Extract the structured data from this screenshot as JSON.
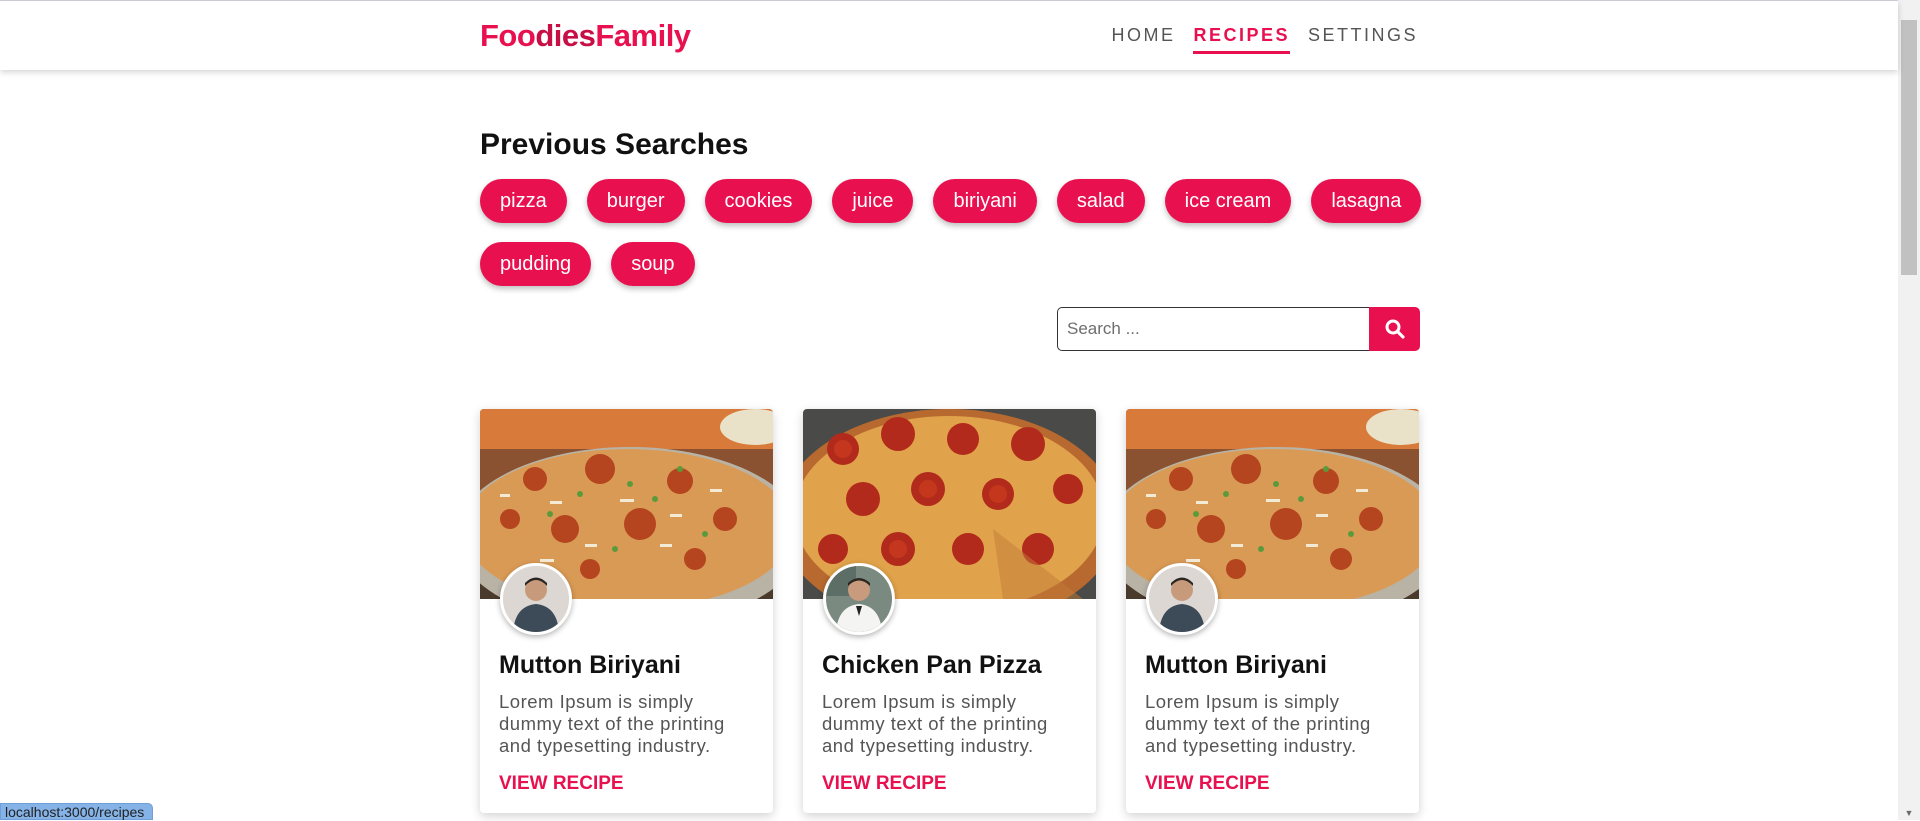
{
  "header": {
    "logo": {
      "part1": "Foo",
      "part2": "dies",
      "part3": "Family"
    },
    "nav": [
      {
        "label": "HOME",
        "active": false
      },
      {
        "label": "RECIPES",
        "active": true
      },
      {
        "label": "SETTINGS",
        "active": false
      }
    ]
  },
  "previous_searches": {
    "title": "Previous Searches",
    "items": [
      "pizza",
      "burger",
      "cookies",
      "juice",
      "biriyani",
      "salad",
      "ice cream",
      "lasagna",
      "pudding",
      "soup"
    ]
  },
  "search": {
    "placeholder": "Search ...",
    "value": "",
    "icon": "search-icon"
  },
  "recipes": [
    {
      "title": "Mutton Biriyani",
      "description": "Lorem Ipsum is simply dummy text of the printing and typesetting industry.",
      "link_label": "VIEW RECIPE",
      "image": "biriyani-image",
      "avatar": "chef-avatar"
    },
    {
      "title": "Chicken Pan Pizza",
      "description": "Lorem Ipsum is simply dummy text of the printing and typesetting industry.",
      "link_label": "VIEW RECIPE",
      "image": "pizza-image",
      "avatar": "chef-avatar"
    },
    {
      "title": "Mutton Biriyani",
      "description": "Lorem Ipsum is simply dummy text of the printing and typesetting industry.",
      "link_label": "VIEW RECIPE",
      "image": "biriyani-image",
      "avatar": "chef-avatar"
    }
  ],
  "status_bar": {
    "url": "localhost:3000/recipes"
  },
  "colors": {
    "accent": "#e8104f",
    "text": "#111111",
    "muted": "#555555"
  }
}
